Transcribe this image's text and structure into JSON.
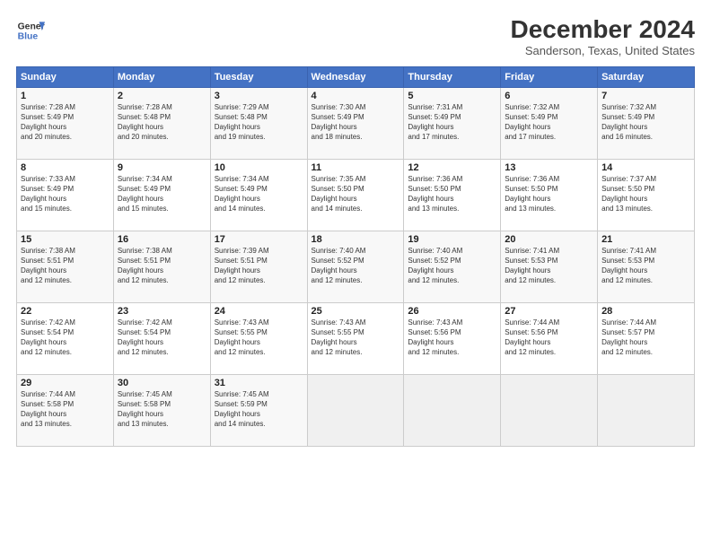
{
  "header": {
    "logo": {
      "line1": "General",
      "line2": "Blue"
    },
    "title": "December 2024",
    "subtitle": "Sanderson, Texas, United States"
  },
  "weekdays": [
    "Sunday",
    "Monday",
    "Tuesday",
    "Wednesday",
    "Thursday",
    "Friday",
    "Saturday"
  ],
  "weeks": [
    [
      {
        "day": "1",
        "sunrise": "7:28 AM",
        "sunset": "5:49 PM",
        "daylight": "10 hours and 20 minutes."
      },
      {
        "day": "2",
        "sunrise": "7:28 AM",
        "sunset": "5:48 PM",
        "daylight": "10 hours and 20 minutes."
      },
      {
        "day": "3",
        "sunrise": "7:29 AM",
        "sunset": "5:48 PM",
        "daylight": "10 hours and 19 minutes."
      },
      {
        "day": "4",
        "sunrise": "7:30 AM",
        "sunset": "5:49 PM",
        "daylight": "10 hours and 18 minutes."
      },
      {
        "day": "5",
        "sunrise": "7:31 AM",
        "sunset": "5:49 PM",
        "daylight": "10 hours and 17 minutes."
      },
      {
        "day": "6",
        "sunrise": "7:32 AM",
        "sunset": "5:49 PM",
        "daylight": "10 hours and 17 minutes."
      },
      {
        "day": "7",
        "sunrise": "7:32 AM",
        "sunset": "5:49 PM",
        "daylight": "10 hours and 16 minutes."
      }
    ],
    [
      {
        "day": "8",
        "sunrise": "7:33 AM",
        "sunset": "5:49 PM",
        "daylight": "10 hours and 15 minutes."
      },
      {
        "day": "9",
        "sunrise": "7:34 AM",
        "sunset": "5:49 PM",
        "daylight": "10 hours and 15 minutes."
      },
      {
        "day": "10",
        "sunrise": "7:34 AM",
        "sunset": "5:49 PM",
        "daylight": "10 hours and 14 minutes."
      },
      {
        "day": "11",
        "sunrise": "7:35 AM",
        "sunset": "5:50 PM",
        "daylight": "10 hours and 14 minutes."
      },
      {
        "day": "12",
        "sunrise": "7:36 AM",
        "sunset": "5:50 PM",
        "daylight": "10 hours and 13 minutes."
      },
      {
        "day": "13",
        "sunrise": "7:36 AM",
        "sunset": "5:50 PM",
        "daylight": "10 hours and 13 minutes."
      },
      {
        "day": "14",
        "sunrise": "7:37 AM",
        "sunset": "5:50 PM",
        "daylight": "10 hours and 13 minutes."
      }
    ],
    [
      {
        "day": "15",
        "sunrise": "7:38 AM",
        "sunset": "5:51 PM",
        "daylight": "10 hours and 12 minutes."
      },
      {
        "day": "16",
        "sunrise": "7:38 AM",
        "sunset": "5:51 PM",
        "daylight": "10 hours and 12 minutes."
      },
      {
        "day": "17",
        "sunrise": "7:39 AM",
        "sunset": "5:51 PM",
        "daylight": "10 hours and 12 minutes."
      },
      {
        "day": "18",
        "sunrise": "7:40 AM",
        "sunset": "5:52 PM",
        "daylight": "10 hours and 12 minutes."
      },
      {
        "day": "19",
        "sunrise": "7:40 AM",
        "sunset": "5:52 PM",
        "daylight": "10 hours and 12 minutes."
      },
      {
        "day": "20",
        "sunrise": "7:41 AM",
        "sunset": "5:53 PM",
        "daylight": "10 hours and 12 minutes."
      },
      {
        "day": "21",
        "sunrise": "7:41 AM",
        "sunset": "5:53 PM",
        "daylight": "10 hours and 12 minutes."
      }
    ],
    [
      {
        "day": "22",
        "sunrise": "7:42 AM",
        "sunset": "5:54 PM",
        "daylight": "10 hours and 12 minutes."
      },
      {
        "day": "23",
        "sunrise": "7:42 AM",
        "sunset": "5:54 PM",
        "daylight": "10 hours and 12 minutes."
      },
      {
        "day": "24",
        "sunrise": "7:43 AM",
        "sunset": "5:55 PM",
        "daylight": "10 hours and 12 minutes."
      },
      {
        "day": "25",
        "sunrise": "7:43 AM",
        "sunset": "5:55 PM",
        "daylight": "10 hours and 12 minutes."
      },
      {
        "day": "26",
        "sunrise": "7:43 AM",
        "sunset": "5:56 PM",
        "daylight": "10 hours and 12 minutes."
      },
      {
        "day": "27",
        "sunrise": "7:44 AM",
        "sunset": "5:56 PM",
        "daylight": "10 hours and 12 minutes."
      },
      {
        "day": "28",
        "sunrise": "7:44 AM",
        "sunset": "5:57 PM",
        "daylight": "10 hours and 12 minutes."
      }
    ],
    [
      {
        "day": "29",
        "sunrise": "7:44 AM",
        "sunset": "5:58 PM",
        "daylight": "10 hours and 13 minutes."
      },
      {
        "day": "30",
        "sunrise": "7:45 AM",
        "sunset": "5:58 PM",
        "daylight": "10 hours and 13 minutes."
      },
      {
        "day": "31",
        "sunrise": "7:45 AM",
        "sunset": "5:59 PM",
        "daylight": "10 hours and 14 minutes."
      },
      null,
      null,
      null,
      null
    ]
  ]
}
